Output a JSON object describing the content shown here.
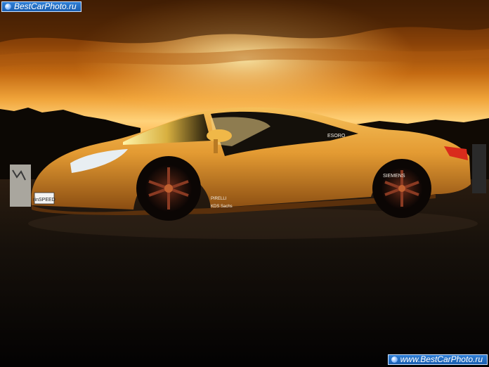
{
  "watermark": {
    "top_text": "BestCarPhoto.ru",
    "bottom_text": "www.BestCarPhoto.ru"
  },
  "car": {
    "plate": "rinSPEED",
    "window_decal": "ESORO",
    "decal_siemens": "SIEMENS",
    "decal_pirelli": "PIRELLI",
    "decal_kds": "KDS Sachs"
  },
  "colors": {
    "sky_top": "#5a2a05",
    "sky_glow": "#ffc35a",
    "body_orange": "#e8a23a",
    "ground": "#0a0806"
  }
}
